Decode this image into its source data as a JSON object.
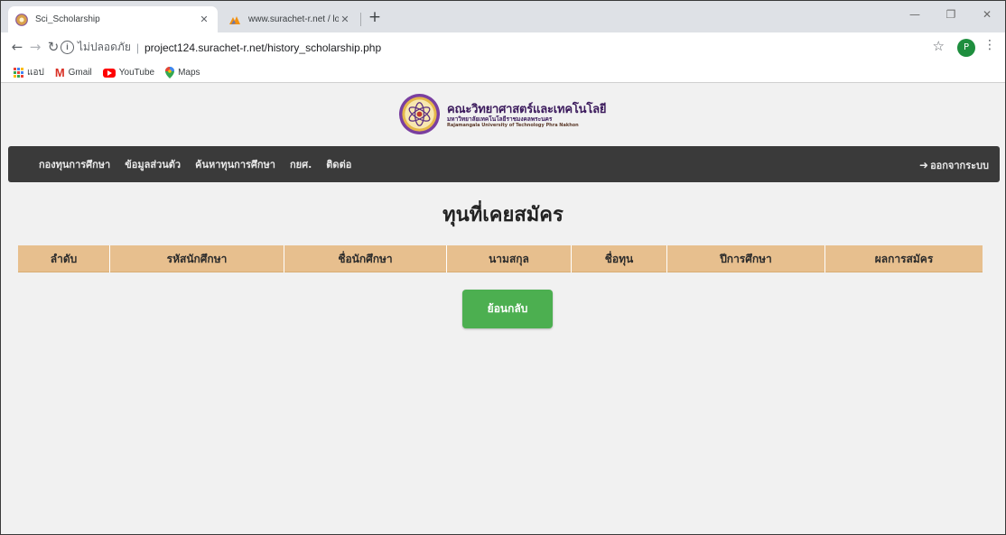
{
  "browser": {
    "tabs": [
      {
        "title": "Sci_Scholarship",
        "active": true
      },
      {
        "title": "www.surachet-r.net / localhost / ",
        "active": false
      }
    ],
    "new_tab": "+",
    "url_security": "ไม่ปลอดภัย",
    "url": "project124.surachet-r.net/history_scholarship.php",
    "profile_initial": "P",
    "bookmarks": [
      "แอป",
      "Gmail",
      "YouTube",
      "Maps"
    ]
  },
  "site": {
    "brand_th": "คณะวิทยาศาสตร์และเทคโนโลยี",
    "brand_th_sub": "มหาวิทยาลัยเทคโนโลยีราชมงคลพระนคร",
    "brand_en": "Rajamangala University of Technology Phra Nakhon",
    "nav": [
      "กองทุนการศึกษา",
      "ข้อมูลส่วนตัว",
      "ค้นหาทุนการศึกษา",
      "กยศ.",
      "ติดต่อ"
    ],
    "logout": "ออกจากระบบ"
  },
  "main": {
    "heading": "ทุนที่เคยสมัคร",
    "columns": [
      "ลำดับ",
      "รหัสนักศึกษา",
      "ชื่อนักศึกษา",
      "นามสกุล",
      "ชื่อทุน",
      "ปีการศึกษา",
      "ผลการสมัคร"
    ],
    "rows": [],
    "back_button": "ย้อนกลับ"
  },
  "colors": {
    "navbar": "#3a3a3a",
    "table_header": "#e7bf8e",
    "back_button": "#4caf50",
    "page_bg": "#f1f1f1"
  }
}
